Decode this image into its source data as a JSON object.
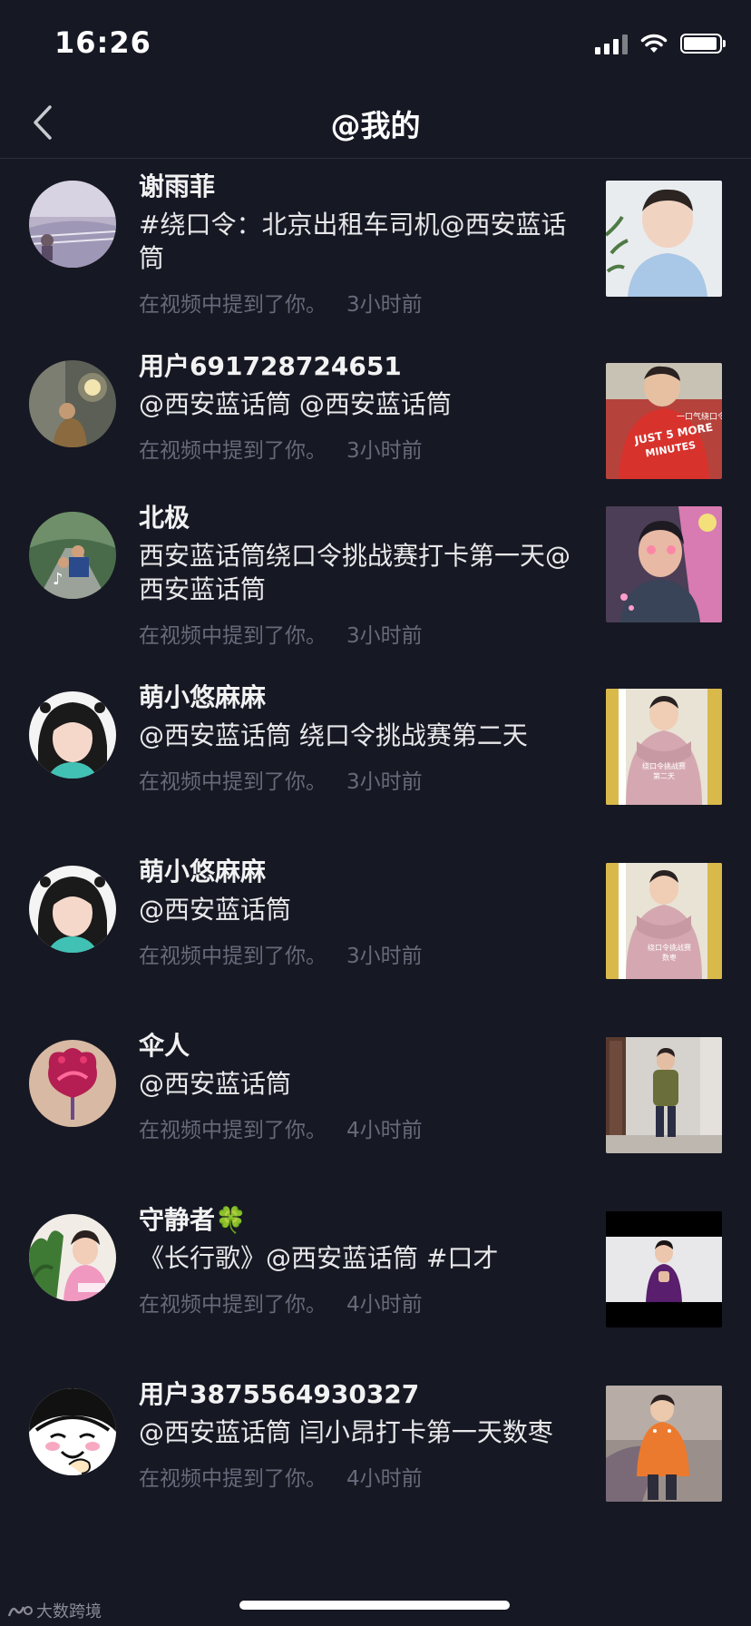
{
  "status_bar": {
    "time": "16:26"
  },
  "nav": {
    "title": "@我的"
  },
  "meta_text": "在视频中提到了你。",
  "rows": [
    {
      "name": "谢雨菲",
      "text": "#绕口令：北京出租车司机@西安蓝话筒",
      "time": "3小时前"
    },
    {
      "name": "用户691728724651",
      "text": "@西安蓝话筒 @西安蓝话筒",
      "time": "3小时前"
    },
    {
      "name": "北极",
      "text": "西安蓝话筒绕口令挑战赛打卡第一天@西安蓝话筒",
      "time": "3小时前"
    },
    {
      "name": "萌小悠麻麻",
      "text": "@西安蓝话筒 绕口令挑战赛第二天",
      "time": "3小时前"
    },
    {
      "name": "萌小悠麻麻",
      "text": "@西安蓝话筒",
      "time": "3小时前"
    },
    {
      "name": "伞人",
      "text": "@西安蓝话筒",
      "time": "4小时前"
    },
    {
      "name": "守静者🍀",
      "text": "《长行歌》@西安蓝话筒 #口才",
      "time": "4小时前"
    },
    {
      "name": "用户3875564930327",
      "text": "@西安蓝话筒 闫小昂打卡第一天数枣",
      "time": "4小时前"
    }
  ],
  "thumb_captions": {
    "row2": "一口气绕口令挑战赛",
    "row4a": "绕口令挑战赛",
    "row4b": "第二天",
    "row5a": "绕口令挑战赛",
    "row5b": "数枣"
  },
  "watermark": "大数跨境",
  "colors": {
    "background": "#161823",
    "secondary_text": "#68697a",
    "divider": "#2c2e38"
  }
}
